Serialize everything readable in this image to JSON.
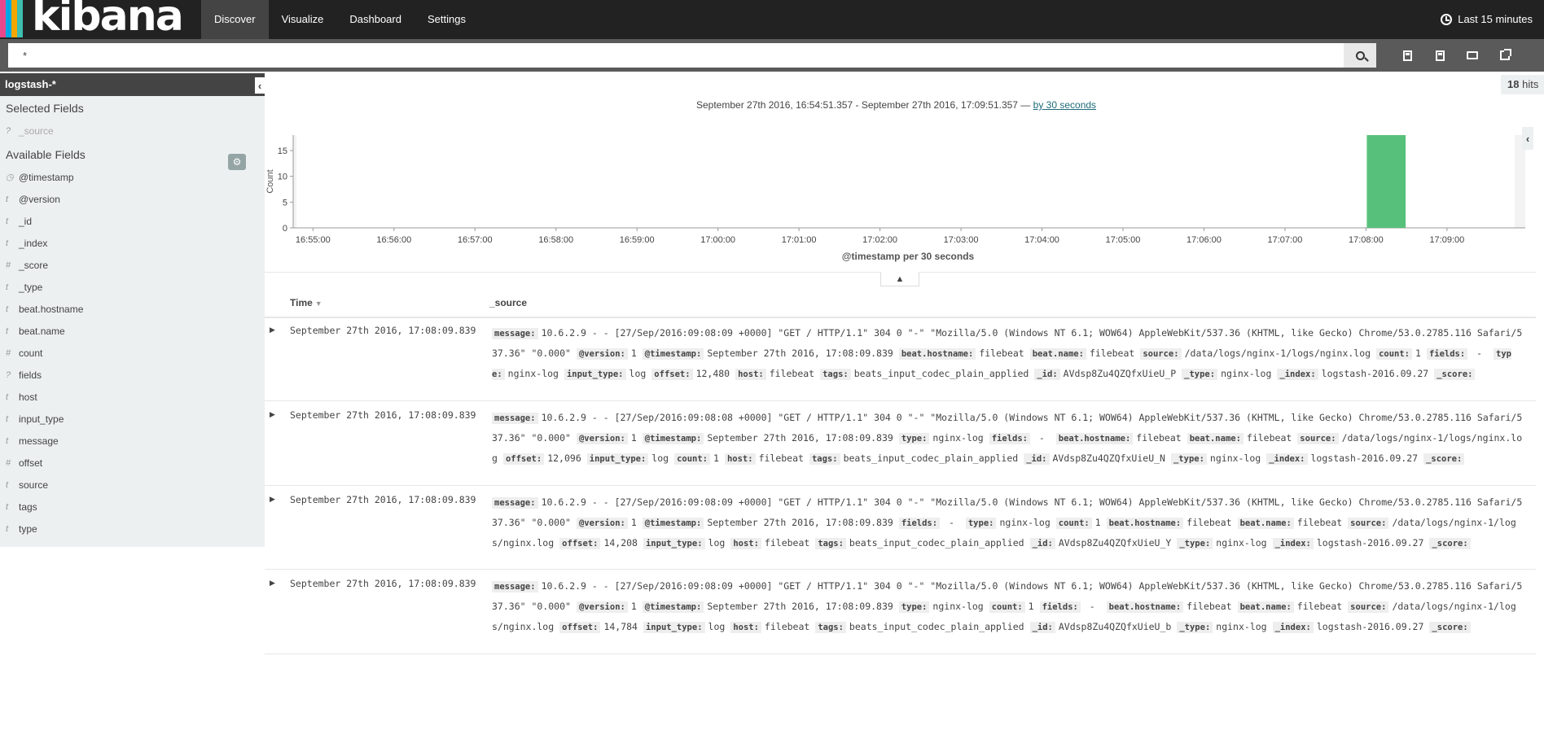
{
  "app": {
    "logo_text": "kibana",
    "logo_colors": [
      "#e8488b",
      "#00a9e5",
      "#f5a700",
      "#3ebeb0",
      "#222222"
    ]
  },
  "nav": {
    "tabs": [
      {
        "label": "Discover",
        "active": true
      },
      {
        "label": "Visualize",
        "active": false
      },
      {
        "label": "Dashboard",
        "active": false
      },
      {
        "label": "Settings",
        "active": false
      }
    ],
    "timepicker_label": "Last 15 minutes"
  },
  "query": {
    "value": "*",
    "icons": [
      "search-icon",
      "new-search-icon",
      "save-search-icon",
      "open-search-icon",
      "share-icon"
    ]
  },
  "sidebar": {
    "index_pattern": "logstash-*",
    "selected_heading": "Selected Fields",
    "selected_fields": [
      {
        "type_icon": "?",
        "name": "_source"
      }
    ],
    "available_heading": "Available Fields",
    "available_fields": [
      {
        "type_icon": "◷",
        "name": "@timestamp"
      },
      {
        "type_icon": "t",
        "name": "@version"
      },
      {
        "type_icon": "t",
        "name": "_id"
      },
      {
        "type_icon": "t",
        "name": "_index"
      },
      {
        "type_icon": "#",
        "name": "_score"
      },
      {
        "type_icon": "t",
        "name": "_type"
      },
      {
        "type_icon": "t",
        "name": "beat.hostname"
      },
      {
        "type_icon": "t",
        "name": "beat.name"
      },
      {
        "type_icon": "#",
        "name": "count"
      },
      {
        "type_icon": "?",
        "name": "fields"
      },
      {
        "type_icon": "t",
        "name": "host"
      },
      {
        "type_icon": "t",
        "name": "input_type"
      },
      {
        "type_icon": "t",
        "name": "message"
      },
      {
        "type_icon": "#",
        "name": "offset"
      },
      {
        "type_icon": "t",
        "name": "source"
      },
      {
        "type_icon": "t",
        "name": "tags"
      },
      {
        "type_icon": "t",
        "name": "type"
      }
    ]
  },
  "results": {
    "hits_count": "18",
    "hits_label": "hits",
    "range_text": "September 27th 2016, 16:54:51.357 - September 27th 2016, 17:09:51.357 —",
    "interval_link": "by 30 seconds"
  },
  "chart_data": {
    "type": "bar",
    "xlabel": "@timestamp per 30 seconds",
    "ylabel": "Count",
    "ylim": [
      0,
      18
    ],
    "yticks": [
      0,
      5,
      10,
      15
    ],
    "x_range": [
      "16:54:51.357",
      "17:09:51.357"
    ],
    "xticks": [
      "16:55:00",
      "16:56:00",
      "16:57:00",
      "16:58:00",
      "16:59:00",
      "17:00:00",
      "17:01:00",
      "17:02:00",
      "17:03:00",
      "17:04:00",
      "17:05:00",
      "17:06:00",
      "17:07:00",
      "17:08:00",
      "17:09:00"
    ],
    "series": [
      {
        "values": [
          {
            "x": "17:08:00",
            "y": 18
          }
        ]
      }
    ],
    "bar_color": "#57c17b",
    "out_of_range_shade": "#f3f3f3"
  },
  "table": {
    "time_header": "Time",
    "source_header": "_source",
    "rows": [
      {
        "time": "September 27th 2016, 17:08:09.839",
        "fields": [
          {
            "k": "message:",
            "v": "10.6.2.9 - - [27/Sep/2016:09:08:09 +0000] \"GET / HTTP/1.1\" 304 0 \"-\" \"Mozilla/5.0 (Windows NT 6.1; WOW64) AppleWebKit/537.36 (KHTML, like Gecko) Chrome/53.0.2785.116 Safari/537.36\" \"0.000\""
          },
          {
            "k": "@version:",
            "v": "1"
          },
          {
            "k": "@timestamp:",
            "v": "September 27th 2016, 17:08:09.839"
          },
          {
            "k": "beat.hostname:",
            "v": "filebeat"
          },
          {
            "k": "beat.name:",
            "v": "filebeat"
          },
          {
            "k": "source:",
            "v": "/data/logs/nginx-1/logs/nginx.log"
          },
          {
            "k": "count:",
            "v": "1"
          },
          {
            "k": "fields:",
            "v": " - "
          },
          {
            "k": "type:",
            "v": "nginx-log"
          },
          {
            "k": "input_type:",
            "v": "log"
          },
          {
            "k": "offset:",
            "v": "12,480"
          },
          {
            "k": "host:",
            "v": "filebeat"
          },
          {
            "k": "tags:",
            "v": "beats_input_codec_plain_applied"
          },
          {
            "k": "_id:",
            "v": "AVdsp8Zu4QZQfxUieU_P"
          },
          {
            "k": "_type:",
            "v": "nginx-log"
          },
          {
            "k": "_index:",
            "v": "logstash-2016.09.27"
          },
          {
            "k": "_score:",
            "v": ""
          }
        ]
      },
      {
        "time": "September 27th 2016, 17:08:09.839",
        "fields": [
          {
            "k": "message:",
            "v": "10.6.2.9 - - [27/Sep/2016:09:08:08 +0000] \"GET / HTTP/1.1\" 304 0 \"-\" \"Mozilla/5.0 (Windows NT 6.1; WOW64) AppleWebKit/537.36 (KHTML, like Gecko) Chrome/53.0.2785.116 Safari/537.36\" \"0.000\""
          },
          {
            "k": "@version:",
            "v": "1"
          },
          {
            "k": "@timestamp:",
            "v": "September 27th 2016, 17:08:09.839"
          },
          {
            "k": "type:",
            "v": "nginx-log"
          },
          {
            "k": "fields:",
            "v": " - "
          },
          {
            "k": "beat.hostname:",
            "v": "filebeat"
          },
          {
            "k": "beat.name:",
            "v": "filebeat"
          },
          {
            "k": "source:",
            "v": "/data/logs/nginx-1/logs/nginx.log"
          },
          {
            "k": "offset:",
            "v": "12,096"
          },
          {
            "k": "input_type:",
            "v": "log"
          },
          {
            "k": "count:",
            "v": "1"
          },
          {
            "k": "host:",
            "v": "filebeat"
          },
          {
            "k": "tags:",
            "v": "beats_input_codec_plain_applied"
          },
          {
            "k": "_id:",
            "v": "AVdsp8Zu4QZQfxUieU_N"
          },
          {
            "k": "_type:",
            "v": "nginx-log"
          },
          {
            "k": "_index:",
            "v": "logstash-2016.09.27"
          },
          {
            "k": "_score:",
            "v": ""
          }
        ]
      },
      {
        "time": "September 27th 2016, 17:08:09.839",
        "fields": [
          {
            "k": "message:",
            "v": "10.6.2.9 - - [27/Sep/2016:09:08:09 +0000] \"GET / HTTP/1.1\" 304 0 \"-\" \"Mozilla/5.0 (Windows NT 6.1; WOW64) AppleWebKit/537.36 (KHTML, like Gecko) Chrome/53.0.2785.116 Safari/537.36\" \"0.000\""
          },
          {
            "k": "@version:",
            "v": "1"
          },
          {
            "k": "@timestamp:",
            "v": "September 27th 2016, 17:08:09.839"
          },
          {
            "k": "fields:",
            "v": " - "
          },
          {
            "k": "type:",
            "v": "nginx-log"
          },
          {
            "k": "count:",
            "v": "1"
          },
          {
            "k": "beat.hostname:",
            "v": "filebeat"
          },
          {
            "k": "beat.name:",
            "v": "filebeat"
          },
          {
            "k": "source:",
            "v": "/data/logs/nginx-1/logs/nginx.log"
          },
          {
            "k": "offset:",
            "v": "14,208"
          },
          {
            "k": "input_type:",
            "v": "log"
          },
          {
            "k": "host:",
            "v": "filebeat"
          },
          {
            "k": "tags:",
            "v": "beats_input_codec_plain_applied"
          },
          {
            "k": "_id:",
            "v": "AVdsp8Zu4QZQfxUieU_Y"
          },
          {
            "k": "_type:",
            "v": "nginx-log"
          },
          {
            "k": "_index:",
            "v": "logstash-2016.09.27"
          },
          {
            "k": "_score:",
            "v": ""
          }
        ]
      },
      {
        "time": "September 27th 2016, 17:08:09.839",
        "fields": [
          {
            "k": "message:",
            "v": "10.6.2.9 - - [27/Sep/2016:09:08:09 +0000] \"GET / HTTP/1.1\" 304 0 \"-\" \"Mozilla/5.0 (Windows NT 6.1; WOW64) AppleWebKit/537.36 (KHTML, like Gecko) Chrome/53.0.2785.116 Safari/537.36\" \"0.000\""
          },
          {
            "k": "@version:",
            "v": "1"
          },
          {
            "k": "@timestamp:",
            "v": "September 27th 2016, 17:08:09.839"
          },
          {
            "k": "type:",
            "v": "nginx-log"
          },
          {
            "k": "count:",
            "v": "1"
          },
          {
            "k": "fields:",
            "v": " - "
          },
          {
            "k": "beat.hostname:",
            "v": "filebeat"
          },
          {
            "k": "beat.name:",
            "v": "filebeat"
          },
          {
            "k": "source:",
            "v": "/data/logs/nginx-1/logs/nginx.log"
          },
          {
            "k": "offset:",
            "v": "14,784"
          },
          {
            "k": "input_type:",
            "v": "log"
          },
          {
            "k": "host:",
            "v": "filebeat"
          },
          {
            "k": "tags:",
            "v": "beats_input_codec_plain_applied"
          },
          {
            "k": "_id:",
            "v": "AVdsp8Zu4QZQfxUieU_b"
          },
          {
            "k": "_type:",
            "v": "nginx-log"
          },
          {
            "k": "_index:",
            "v": "logstash-2016.09.27"
          },
          {
            "k": "_score:",
            "v": ""
          }
        ]
      }
    ]
  }
}
